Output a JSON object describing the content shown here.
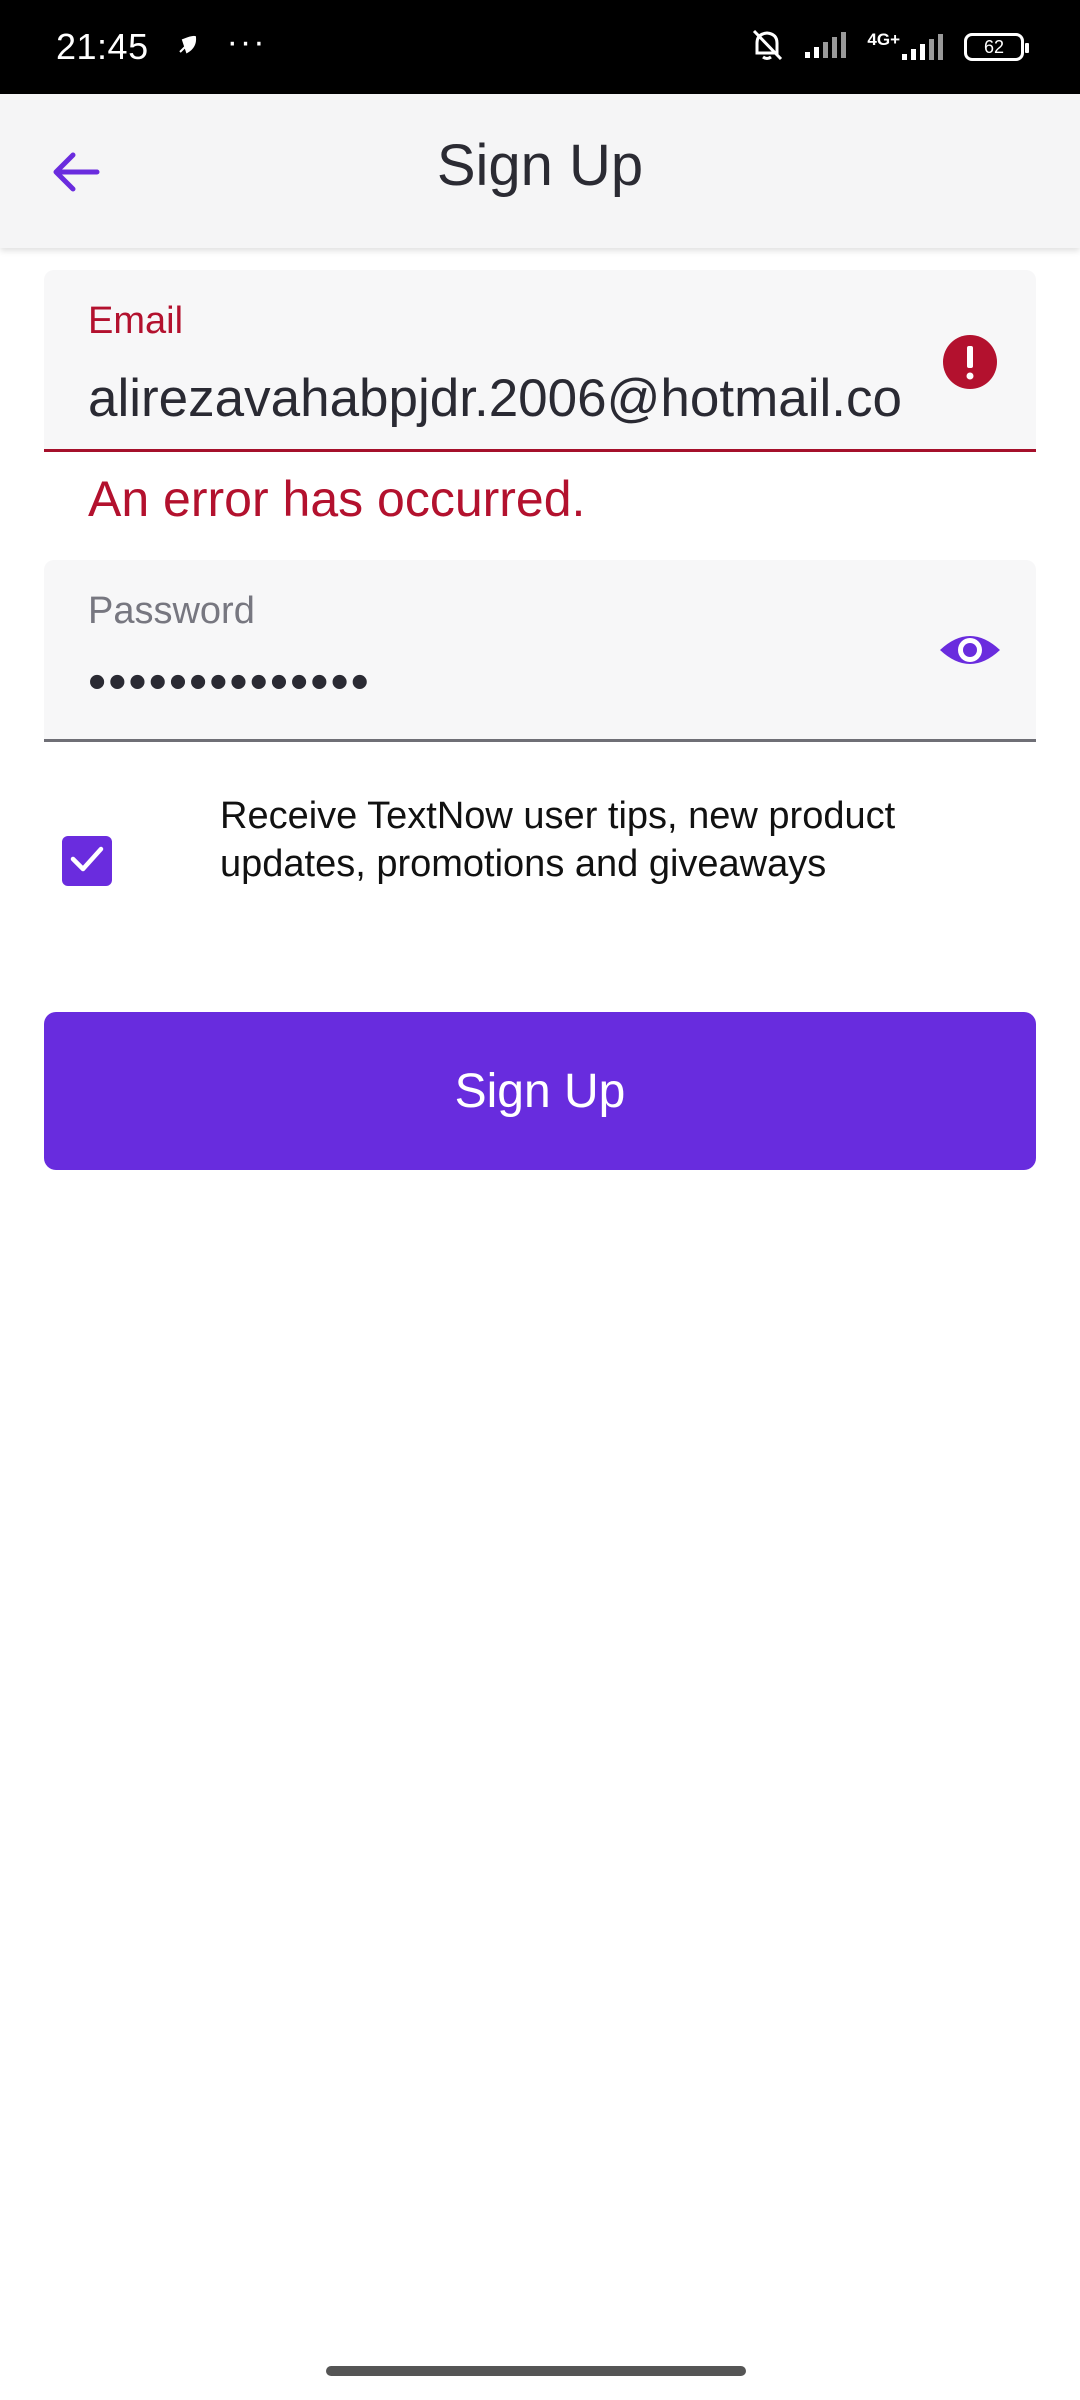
{
  "status_bar": {
    "time": "21:45",
    "more": "···",
    "network": "4G+",
    "battery": "62",
    "icons": [
      "moon-leaf-icon",
      "mute-bell-icon",
      "signal-icon",
      "signal-4g-icon",
      "battery-icon"
    ]
  },
  "app_bar": {
    "title": "Sign Up",
    "back_icon": "arrow-left-icon"
  },
  "form": {
    "email": {
      "label": "Email",
      "value": "alirezavahabpjdr.2006@hotmail.co",
      "error_icon": "exclamation-circle-icon",
      "error_text": "An error has occurred."
    },
    "password": {
      "label": "Password",
      "value": "••••••••••••••",
      "toggle_icon": "eye-icon"
    },
    "consent": {
      "checked": true,
      "text": "Receive TextNow user tips, new product updates, promotions and giveaways"
    },
    "submit_label": "Sign Up"
  },
  "colors": {
    "accent": "#682cde",
    "error": "#b3112e",
    "app_bar_bg": "#f5f5f6",
    "field_bg": "#f7f7f8"
  }
}
